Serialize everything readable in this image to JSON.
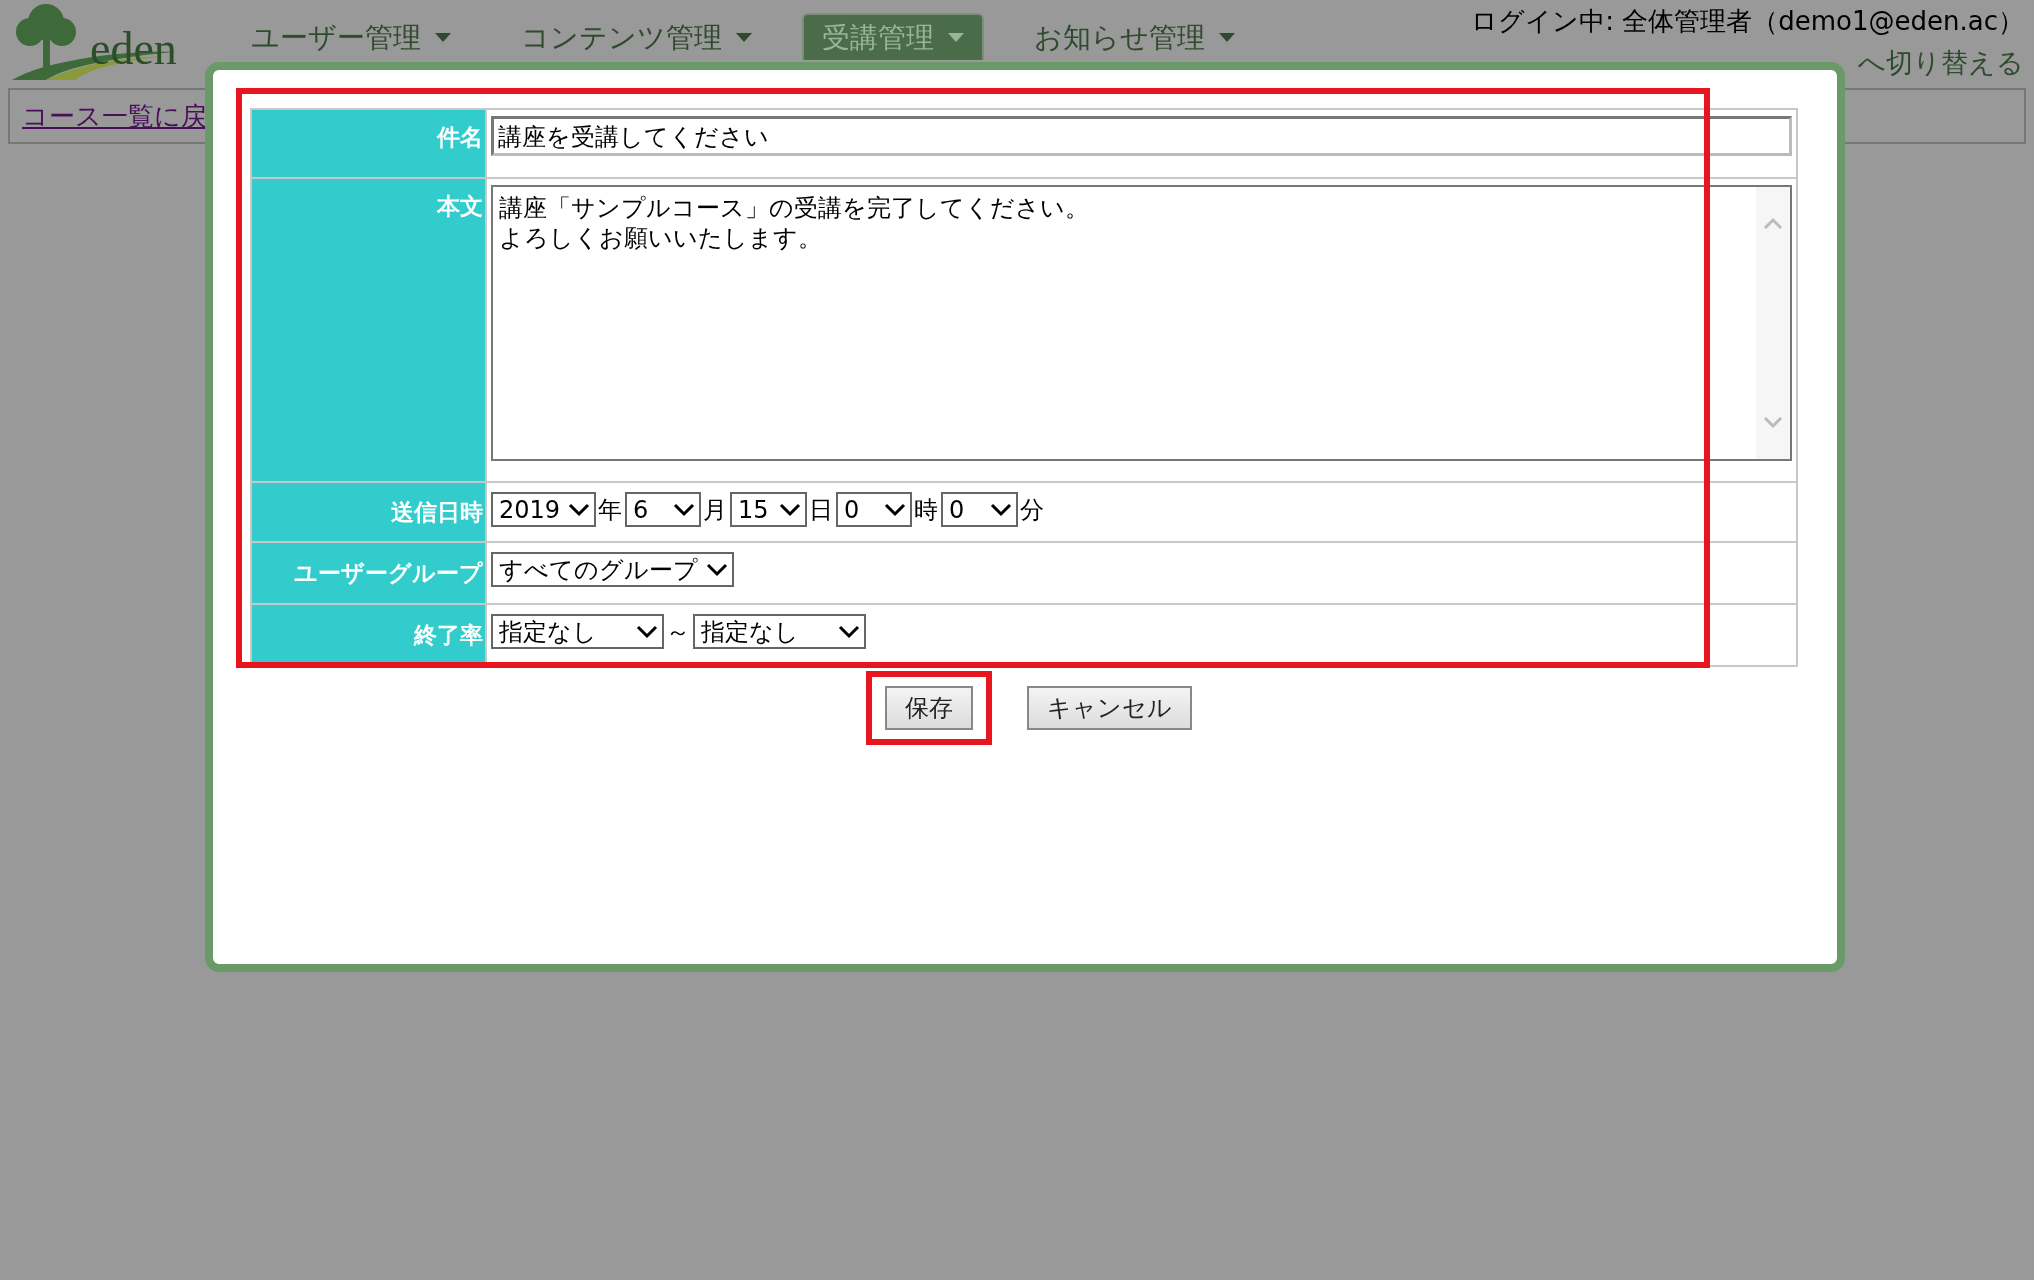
{
  "header": {
    "logo_text": "eden",
    "nav": [
      {
        "label": "ユーザー管理",
        "selected": false
      },
      {
        "label": "コンテンツ管理",
        "selected": false
      },
      {
        "label": "受講管理",
        "selected": true
      },
      {
        "label": "お知らせ管理",
        "selected": false
      }
    ],
    "login": "ログイン中: 全体管理者（demo1@eden.ac）",
    "switch_link": "へ切り替える",
    "back_link": "コース一覧に戻"
  },
  "dialog": {
    "highlighted": true,
    "fields": [
      {
        "kind": "text",
        "label": "件名",
        "value": "講座を受講してください"
      },
      {
        "kind": "textarea",
        "label": "本文",
        "lines": [
          "講座「サンプルコース」の受講を完了してください。",
          "よろしくお願いいたします。"
        ]
      },
      {
        "kind": "selects",
        "label": "送信日時",
        "parts": [
          {
            "value": "2019",
            "suffix": "年"
          },
          {
            "value": "6",
            "suffix": "月"
          },
          {
            "value": "15",
            "suffix": "日"
          },
          {
            "value": "0",
            "suffix": "時"
          },
          {
            "value": "0",
            "suffix": "分"
          }
        ]
      },
      {
        "kind": "selects",
        "label": "ユーザーグループ",
        "parts": [
          {
            "value": "すべてのグループ"
          }
        ]
      },
      {
        "kind": "selects",
        "label": "終了率",
        "parts": [
          {
            "value": "指定なし",
            "suffix": "～"
          },
          {
            "value": "指定なし"
          }
        ]
      }
    ],
    "buttons": [
      {
        "label": "保存",
        "highlighted": true
      },
      {
        "label": "キャンセル",
        "highlighted": false
      }
    ]
  }
}
